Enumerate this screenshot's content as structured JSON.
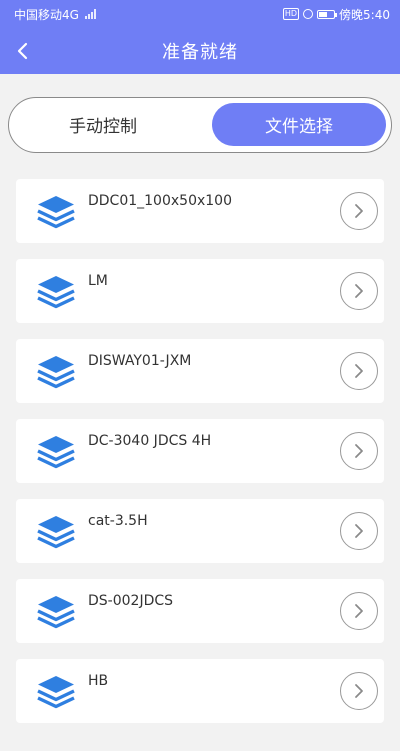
{
  "status_bar": {
    "carrier": "中国移动4G",
    "network_badge": "4G",
    "hd_badge": "HD",
    "time": "傍晚5:40",
    "battery_level": 0.6
  },
  "nav": {
    "title": "准备就绪",
    "back_icon": "chevron-left-icon"
  },
  "segments": [
    {
      "label": "手动控制",
      "active": false
    },
    {
      "label": "文件选择",
      "active": true
    }
  ],
  "files": [
    {
      "name": "DDC01_100x50x100"
    },
    {
      "name": "LM"
    },
    {
      "name": "DISWAY01-JXM"
    },
    {
      "name": "DC-3040 JDCS 4H"
    },
    {
      "name": "cat-3.5H"
    },
    {
      "name": "DS-002JDCS"
    },
    {
      "name": "HB"
    }
  ],
  "colors": {
    "accent": "#6f7ef5",
    "icon_blue": "#2f7fe0",
    "background": "#f2f2f2"
  }
}
